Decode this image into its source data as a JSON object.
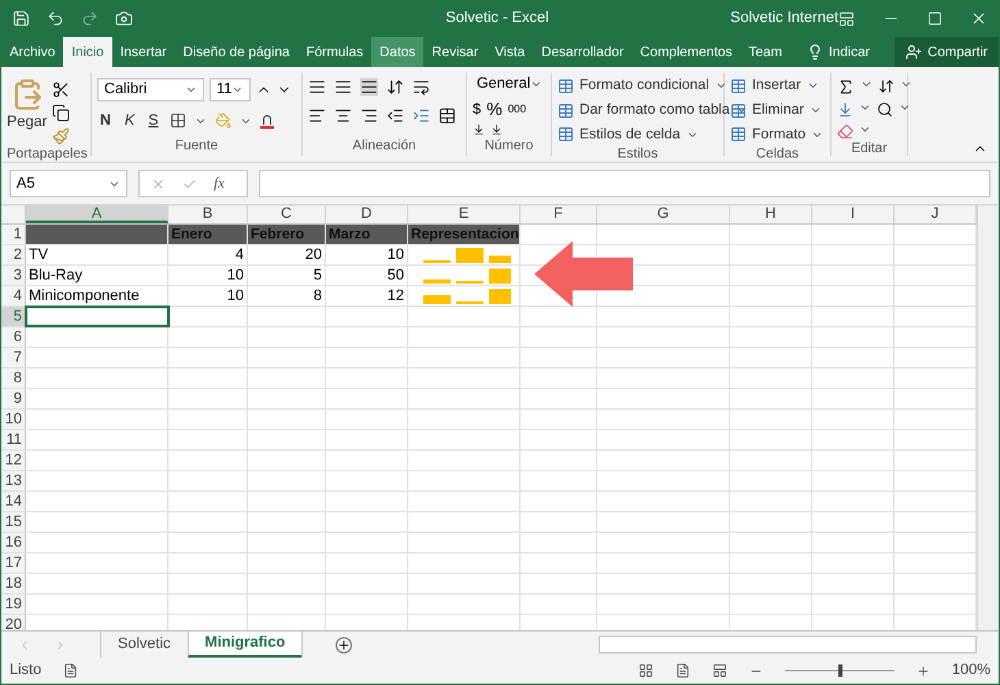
{
  "window": {
    "title": "Solvetic - Excel",
    "user": "Solvetic Internet"
  },
  "tabs": [
    {
      "label": "Archivo",
      "selected": false,
      "highlighted": false
    },
    {
      "label": "Inicio",
      "selected": true,
      "highlighted": false
    },
    {
      "label": "Insertar",
      "selected": false,
      "highlighted": false
    },
    {
      "label": "Diseño de página",
      "selected": false,
      "highlighted": false
    },
    {
      "label": "Fórmulas",
      "selected": false,
      "highlighted": false
    },
    {
      "label": "Datos",
      "selected": false,
      "highlighted": true
    },
    {
      "label": "Revisar",
      "selected": false,
      "highlighted": false
    },
    {
      "label": "Vista",
      "selected": false,
      "highlighted": false
    },
    {
      "label": "Desarrollador",
      "selected": false,
      "highlighted": false
    },
    {
      "label": "Complementos",
      "selected": false,
      "highlighted": false
    },
    {
      "label": "Team",
      "selected": false,
      "highlighted": false
    }
  ],
  "tell_me": "Indicar",
  "share": "Compartir",
  "ribbon": [
    {
      "name": "Portapapeles",
      "kind": "clipboard",
      "paste": "Pegar"
    },
    {
      "name": "Fuente",
      "kind": "font",
      "font": "Calibri",
      "size": "11",
      "bold": "N",
      "italic": "K",
      "underline": "S"
    },
    {
      "name": "Alineación",
      "kind": "alignment"
    },
    {
      "name": "Número",
      "kind": "number",
      "format": "General",
      "currency": "$",
      "percent": "%",
      "thousands": "000"
    },
    {
      "name": "Estilos",
      "kind": "list",
      "items": [
        "Formato condicional",
        "Dar formato como tabla",
        "Estilos de celda"
      ]
    },
    {
      "name": "Celdas",
      "kind": "list",
      "items": [
        "Insertar",
        "Eliminar",
        "Formato"
      ]
    },
    {
      "name": "Editar",
      "kind": "editing"
    }
  ],
  "formula_bar": {
    "name_box": "A5",
    "fx": "fx"
  },
  "grid": {
    "columns": [
      {
        "label": "A",
        "selected": true
      },
      {
        "label": "B",
        "selected": false
      },
      {
        "label": "C",
        "selected": false
      },
      {
        "label": "D",
        "selected": false
      },
      {
        "label": "E",
        "selected": false
      },
      {
        "label": "F",
        "selected": false
      },
      {
        "label": "G",
        "selected": false
      },
      {
        "label": "H",
        "selected": false
      },
      {
        "label": "I",
        "selected": false
      },
      {
        "label": "J",
        "selected": false
      }
    ],
    "rows": [
      {
        "label": "1",
        "selected": false,
        "header": true,
        "cells": [
          {
            "selected": false
          },
          {
            "text": "Enero",
            "selected": false
          },
          {
            "text": "Febrero",
            "selected": false
          },
          {
            "text": "Marzo",
            "selected": false
          },
          {
            "text": "Representacion",
            "selected": false
          }
        ]
      },
      {
        "label": "2",
        "selected": false,
        "header": false,
        "sparkline": true,
        "cells": [
          {
            "text": "TV",
            "selected": false
          },
          {
            "text": "4",
            "selected": false
          },
          {
            "text": "20",
            "selected": false
          },
          {
            "text": "10",
            "selected": false
          }
        ]
      },
      {
        "label": "3",
        "selected": false,
        "header": false,
        "sparkline": true,
        "cells": [
          {
            "text": "Blu-Ray",
            "selected": false
          },
          {
            "text": "10",
            "selected": false
          },
          {
            "text": "5",
            "selected": false
          },
          {
            "text": "50",
            "selected": false
          }
        ]
      },
      {
        "label": "4",
        "selected": false,
        "header": false,
        "sparkline": true,
        "cells": [
          {
            "text": "Minicomponente",
            "selected": false
          },
          {
            "text": "10",
            "selected": false
          },
          {
            "text": "8",
            "selected": false
          },
          {
            "text": "12",
            "selected": false
          }
        ]
      },
      {
        "label": "5",
        "selected": true,
        "header": false,
        "cells": [
          {
            "selected": true
          }
        ]
      },
      {
        "label": "6",
        "selected": false
      },
      {
        "label": "7",
        "selected": false
      },
      {
        "label": "8",
        "selected": false
      },
      {
        "label": "9",
        "selected": false
      },
      {
        "label": "10",
        "selected": false
      },
      {
        "label": "11",
        "selected": false
      },
      {
        "label": "12",
        "selected": false
      },
      {
        "label": "13",
        "selected": false
      },
      {
        "label": "14",
        "selected": false
      },
      {
        "label": "15",
        "selected": false
      },
      {
        "label": "16",
        "selected": false
      },
      {
        "label": "17",
        "selected": false
      },
      {
        "label": "18",
        "selected": false
      },
      {
        "label": "19",
        "selected": false
      },
      {
        "label": "20",
        "selected": false
      }
    ]
  },
  "sheets": [
    {
      "label": "Solvetic",
      "selected": false
    },
    {
      "label": "Minigrafico",
      "selected": true
    }
  ],
  "status_bar": {
    "status": "Listo",
    "zoom": "100%",
    "zoom_slider": {
      "level": 0.5
    }
  }
}
